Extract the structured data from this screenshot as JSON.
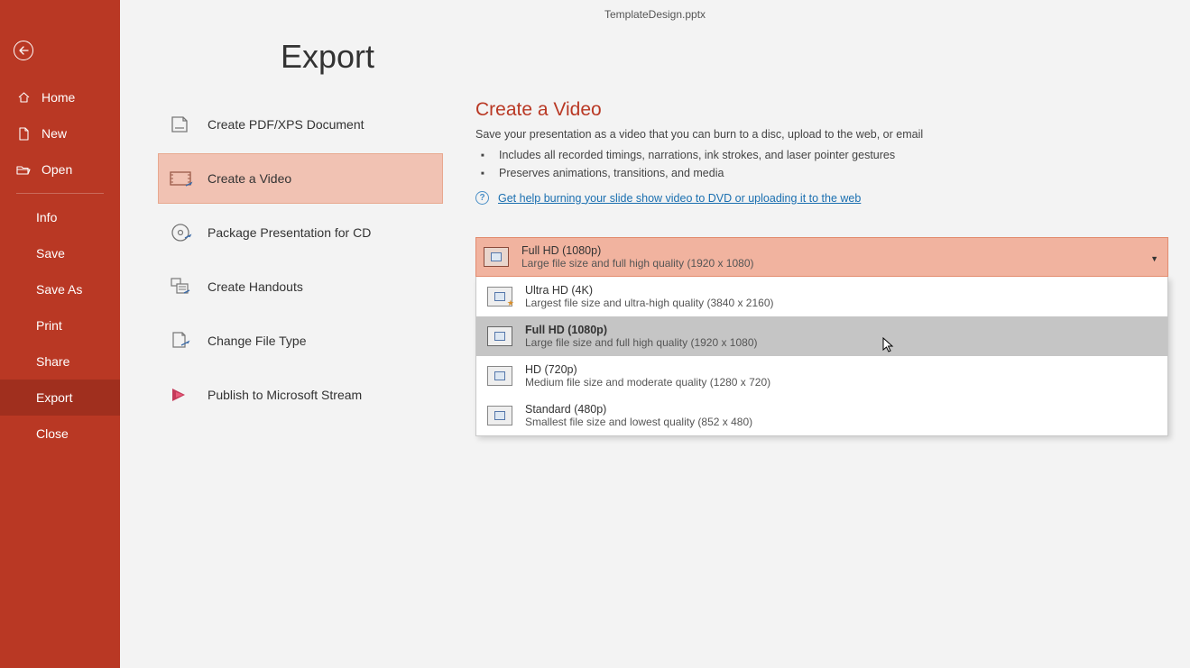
{
  "window": {
    "title": "TemplateDesign.pptx"
  },
  "page": {
    "title": "Export"
  },
  "sidebar": {
    "home": "Home",
    "new": "New",
    "open": "Open",
    "info": "Info",
    "save": "Save",
    "saveas": "Save As",
    "print": "Print",
    "share": "Share",
    "export": "Export",
    "close": "Close"
  },
  "export_options": [
    {
      "label": "Create PDF/XPS Document"
    },
    {
      "label": "Create a Video"
    },
    {
      "label": "Package Presentation for CD"
    },
    {
      "label": "Create Handouts"
    },
    {
      "label": "Change File Type"
    },
    {
      "label": "Publish to Microsoft Stream"
    }
  ],
  "video_pane": {
    "title": "Create a Video",
    "subtitle": "Save your presentation as a video that you can burn to a disc, upload to the web, or email",
    "bullets": [
      "Includes all recorded timings, narrations, ink strokes, and laser pointer gestures",
      "Preserves animations, transitions, and media"
    ],
    "help_text": "Get help burning your slide show video to DVD or uploading it to the web"
  },
  "quality": {
    "selected": {
      "title": "Full HD (1080p)",
      "desc": "Large file size and full high quality (1920 x 1080)"
    },
    "options": [
      {
        "title": "Ultra HD (4K)",
        "desc": "Largest file size and ultra-high quality (3840 x 2160)"
      },
      {
        "title": "Full HD (1080p)",
        "desc": "Large file size and full high quality (1920 x 1080)"
      },
      {
        "title": "HD (720p)",
        "desc": "Medium file size and moderate quality (1280 x 720)"
      },
      {
        "title": "Standard (480p)",
        "desc": "Smallest file size and lowest quality (852 x 480)"
      }
    ]
  }
}
